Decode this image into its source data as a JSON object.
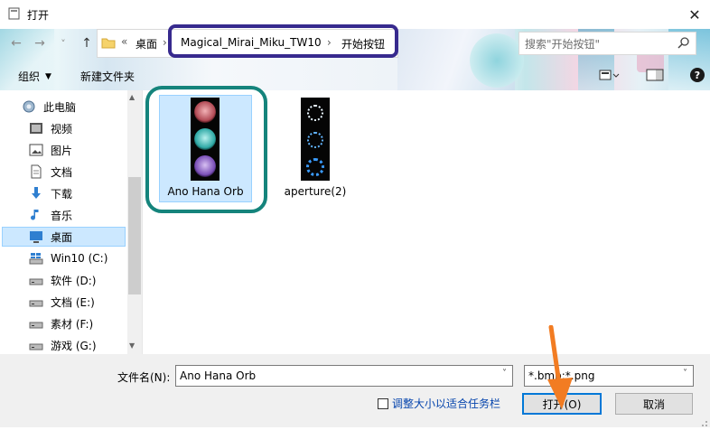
{
  "window": {
    "title": "打开",
    "close_glyph": "✕"
  },
  "nav": {
    "back": "←",
    "forward": "→",
    "dropdown": "˅",
    "up": "↑"
  },
  "address": {
    "overflow": "«",
    "crumbs": [
      "桌面",
      "Magical_Mirai_Miku_TW10",
      "开始按钮"
    ],
    "sep": "›"
  },
  "search": {
    "placeholder": "搜索\"开始按钮\""
  },
  "toolbar": {
    "organize": "组织",
    "new_folder": "新建文件夹"
  },
  "sidebar": {
    "items": [
      {
        "label": "此电脑",
        "icon": "computer-icon"
      },
      {
        "label": "视频",
        "icon": "video-icon"
      },
      {
        "label": "图片",
        "icon": "pictures-icon"
      },
      {
        "label": "文档",
        "icon": "documents-icon"
      },
      {
        "label": "下载",
        "icon": "download-icon"
      },
      {
        "label": "音乐",
        "icon": "music-icon"
      },
      {
        "label": "桌面",
        "icon": "desktop-icon",
        "selected": true
      },
      {
        "label": "Win10 (C:)",
        "icon": "drive-icon"
      },
      {
        "label": "软件 (D:)",
        "icon": "drive-icon"
      },
      {
        "label": "文档 (E:)",
        "icon": "drive-icon"
      },
      {
        "label": "素材 (F:)",
        "icon": "drive-icon"
      },
      {
        "label": "游戏 (G:)",
        "icon": "drive-icon"
      }
    ]
  },
  "files": [
    {
      "name": "Ano Hana Orb",
      "selected": true
    },
    {
      "name": "aperture(2)",
      "selected": false
    }
  ],
  "footer": {
    "filename_label": "文件名(N):",
    "filename_value": "Ano Hana Orb",
    "filetype_value": "*.bmp;*.png",
    "taskbar_checkbox_label": "调整大小以适合任务栏",
    "open_label": "打开(O)",
    "cancel_label": "取消"
  },
  "colors": {
    "selection_fill": "#cce8ff",
    "address_highlight": "#372a8e",
    "file_highlight": "#15847c",
    "arrow": "#f27c22",
    "link": "#0645ad"
  }
}
